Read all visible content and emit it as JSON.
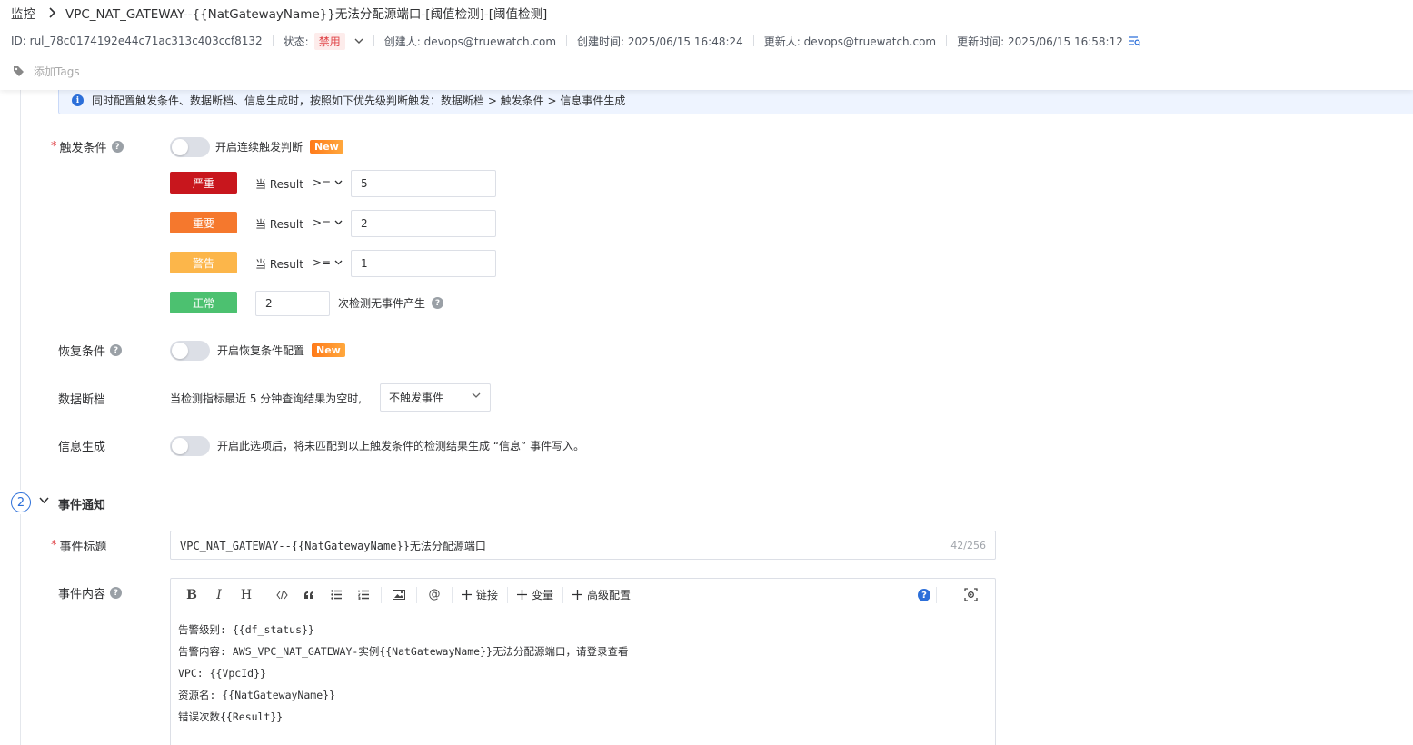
{
  "breadcrumb": {
    "root": "监控",
    "title": "VPC_NAT_GATEWAY--{{NatGatewayName}}无法分配源端口-[阈值检测]-[阈值检测]"
  },
  "meta": {
    "id": "ID: rul_78c0174192e44c71ac313c403ccf8132",
    "status_label": "状态:",
    "status_value": "禁用",
    "creator": "创建人: devops@truewatch.com",
    "created_at": "创建时间: 2025/06/15 16:48:24",
    "updater": "更新人: devops@truewatch.com",
    "updated_at": "更新时间: 2025/06/15 16:58:12"
  },
  "tags": {
    "add_label": "添加Tags"
  },
  "info_bar": {
    "text": "同时配置触发条件、数据断档、信息生成时，按照如下优先级判断触发：数据断档 > 触发条件 > 信息事件生成"
  },
  "trigger": {
    "label": "触发条件",
    "toggle_text": "开启连续触发判断",
    "new_badge": "New",
    "levels": [
      {
        "name": "严重",
        "color": "#c8161d",
        "cond": "当 Result",
        "op": ">=",
        "value": "5"
      },
      {
        "name": "重要",
        "color": "#f5782d",
        "cond": "当 Result",
        "op": ">=",
        "value": "2"
      },
      {
        "name": "警告",
        "color": "#fcb64a",
        "cond": "当 Result",
        "op": ">=",
        "value": "1"
      }
    ],
    "normal": {
      "name": "正常",
      "color": "#4cc170",
      "value": "2",
      "suffix": "次检测无事件产生"
    }
  },
  "recovery": {
    "label": "恢复条件",
    "toggle_text": "开启恢复条件配置",
    "new_badge": "New"
  },
  "data_gap": {
    "label": "数据断档",
    "text": "当检测指标最近 5 分钟查询结果为空时,",
    "select_value": "不触发事件"
  },
  "info_gen": {
    "label": "信息生成",
    "toggle_text": "开启此选项后，将未匹配到以上触发条件的检测结果生成 “信息” 事件写入。"
  },
  "section2": {
    "number": "2",
    "title": "事件通知"
  },
  "event_title": {
    "label": "事件标题",
    "value": "VPC_NAT_GATEWAY--{{NatGatewayName}}无法分配源端口",
    "counter": "42/256"
  },
  "event_content": {
    "label": "事件内容",
    "toolbar": {
      "link": "链接",
      "variable": "变量",
      "advanced": "高级配置",
      "at": "@"
    },
    "lines": [
      "告警级别: {{df_status}}",
      "告警内容: AWS_VPC_NAT_GATEWAY-实例{{NatGatewayName}}无法分配源端口，请登录查看",
      "VPC: {{VpcId}}",
      "资源名: {{NatGatewayName}}",
      "错误次数{{Result}}"
    ]
  }
}
